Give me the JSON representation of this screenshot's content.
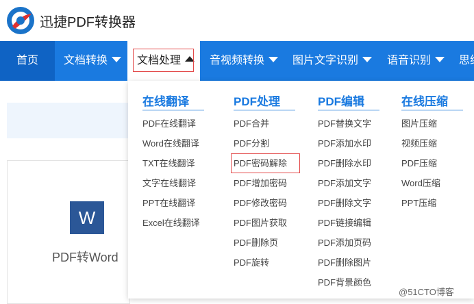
{
  "header": {
    "app_title": "迅捷PDF转换器",
    "logo_icon": "app-logo-icon"
  },
  "nav": {
    "home": "首页",
    "items": [
      "文档转换",
      "文档处理",
      "音视频转换",
      "图片文字识别",
      "语音识别",
      "思维"
    ],
    "active_index": 1
  },
  "card": {
    "tile_letter": "W",
    "label": "PDF转Word"
  },
  "dropdown": {
    "columns": [
      {
        "title": "在线翻译",
        "items": [
          "PDF在线翻译",
          "Word在线翻译",
          "TXT在线翻译",
          "文字在线翻译",
          "PPT在线翻译",
          "Excel在线翻译"
        ]
      },
      {
        "title": "PDF处理",
        "items": [
          "PDF合并",
          "PDF分割",
          "PDF密码解除",
          "PDF增加密码",
          "PDF修改密码",
          "PDF图片获取",
          "PDF删除页",
          "PDF旋转"
        ]
      },
      {
        "title": "PDF编辑",
        "items": [
          "PDF替换文字",
          "PDF添加水印",
          "PDF删除水印",
          "PDF添加文字",
          "PDF删除文字",
          "PDF链接编辑",
          "PDF添加页码",
          "PDF删除图片",
          "PDF背景颜色"
        ]
      },
      {
        "title": "在线压缩",
        "items": [
          "图片压缩",
          "视频压缩",
          "PDF压缩",
          "Word压缩",
          "PPT压缩"
        ]
      }
    ],
    "highlighted": "PDF密码解除"
  },
  "watermark": "@51CTO博客",
  "colors": {
    "nav_bg": "#1a7ae0",
    "nav_home_bg": "#0f63c4",
    "title_blue": "#1a7ae0",
    "highlight_red": "#e34a4a"
  }
}
